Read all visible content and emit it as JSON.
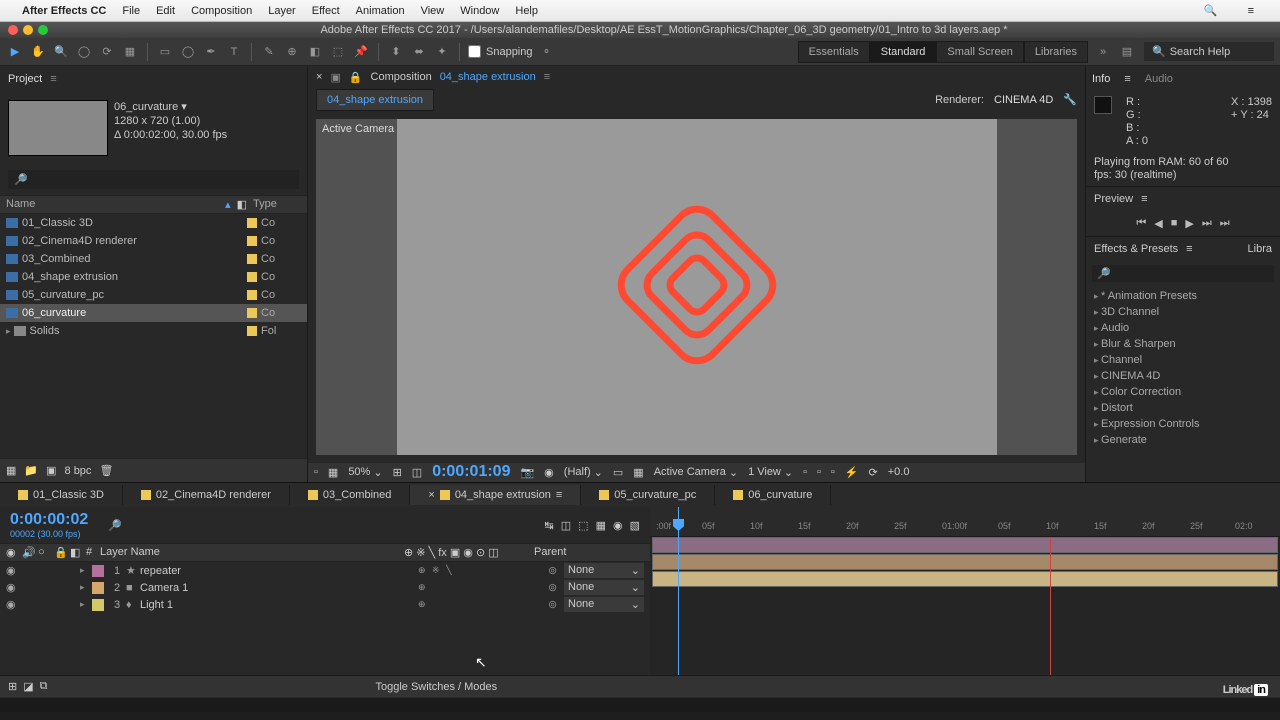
{
  "mac_menu": {
    "app": "After Effects CC",
    "items": [
      "File",
      "Edit",
      "Composition",
      "Layer",
      "Effect",
      "Animation",
      "View",
      "Window",
      "Help"
    ]
  },
  "window_title": "Adobe After Effects CC 2017 - /Users/alandemafiles/Desktop/AE EssT_MotionGraphics/Chapter_06_3D geometry/01_Intro to 3d layers.aep *",
  "snapping": "Snapping",
  "workspaces": {
    "items": [
      "Essentials",
      "Standard",
      "Small Screen",
      "Libraries"
    ],
    "active": 1
  },
  "search_help": "Search Help",
  "project": {
    "label": "Project",
    "selected": "06_curvature",
    "meta1": "1280 x 720 (1.00)",
    "meta2": "Δ 0:00:02:00, 30.00 fps",
    "col_name": "Name",
    "col_type": "Type",
    "items": [
      {
        "name": "01_Classic 3D",
        "type": "Co"
      },
      {
        "name": "02_Cinema4D renderer",
        "type": "Co"
      },
      {
        "name": "03_Combined",
        "type": "Co"
      },
      {
        "name": "04_shape extrusion",
        "type": "Co"
      },
      {
        "name": "05_curvature_pc",
        "type": "Co"
      },
      {
        "name": "06_curvature",
        "type": "Co",
        "sel": true
      },
      {
        "name": "Solids",
        "type": "Fol",
        "folder": true
      }
    ],
    "bpc": "8 bpc"
  },
  "comp": {
    "prefix": "Composition",
    "name": "04_shape extrusion",
    "tab": "04_shape extrusion",
    "renderer_label": "Renderer:",
    "renderer": "CINEMA 4D",
    "camera": "Active Camera"
  },
  "viewer": {
    "zoom": "50%",
    "timecode": "0:00:01:09",
    "res": "(Half)",
    "cam": "Active Camera",
    "views": "1 View",
    "exposure": "+0.0"
  },
  "info": {
    "tab": "Info",
    "tab2": "Audio",
    "r": "R :",
    "g": "G :",
    "b": "B :",
    "a": "A :  0",
    "x": "X : 1398",
    "y": "Y : 24",
    "plus": "+",
    "status1": "Playing from RAM: 60 of 60",
    "status2": "fps: 30 (realtime)"
  },
  "preview": {
    "label": "Preview"
  },
  "effects": {
    "label": "Effects & Presets",
    "tab2": "Libra",
    "cats": [
      "* Animation Presets",
      "3D Channel",
      "Audio",
      "Blur & Sharpen",
      "Channel",
      "CINEMA 4D",
      "Color Correction",
      "Distort",
      "Expression Controls",
      "Generate"
    ]
  },
  "timeline": {
    "tabs": [
      "01_Classic 3D",
      "02_Cinema4D renderer",
      "03_Combined",
      "04_shape extrusion",
      "05_curvature_pc",
      "06_curvature"
    ],
    "active": 3,
    "timecode": "0:00:00:02",
    "frames": "00002 (30.00 fps)",
    "col_num": "#",
    "col_layer": "Layer Name",
    "col_parent": "Parent",
    "layers": [
      {
        "num": "1",
        "name": "repeater",
        "icon": "★",
        "color": "c1",
        "parent": "None",
        "sw": "⊕ ※ ╲"
      },
      {
        "num": "2",
        "name": "Camera 1",
        "icon": "■",
        "color": "c2",
        "parent": "None",
        "sw": "⊕"
      },
      {
        "num": "3",
        "name": "Light 1",
        "icon": "♦",
        "color": "c3",
        "parent": "None",
        "sw": "⊕"
      }
    ],
    "ruler": [
      ":00f",
      "05f",
      "10f",
      "15f",
      "20f",
      "25f",
      "01:00f",
      "05f",
      "10f",
      "15f",
      "20f",
      "25f",
      "02:0"
    ],
    "toggle": "Toggle Switches / Modes"
  },
  "brand": "Linked"
}
